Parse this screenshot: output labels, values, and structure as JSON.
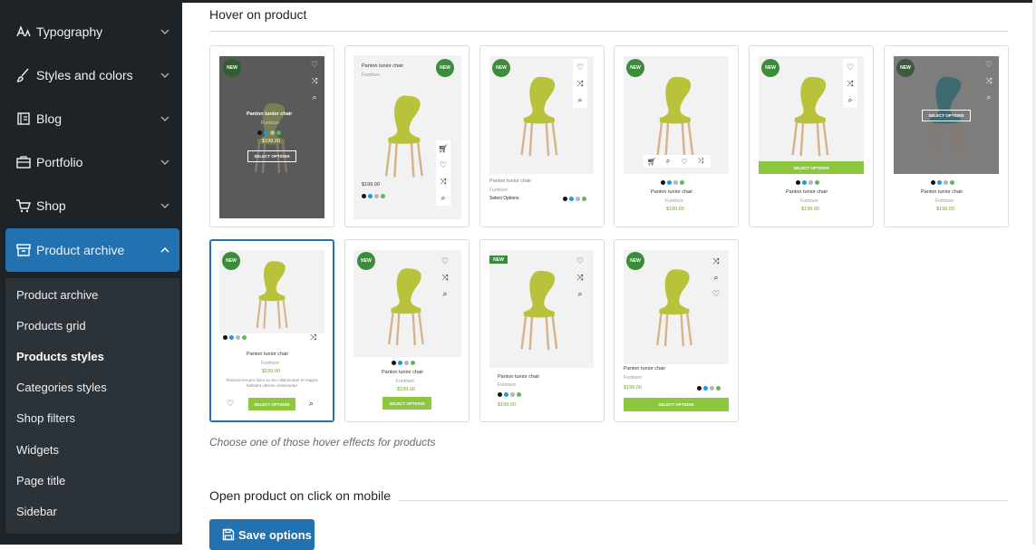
{
  "sidebar": {
    "items": [
      {
        "label": "Typography",
        "icon": "typography-icon"
      },
      {
        "label": "Styles and colors",
        "icon": "brush-icon"
      },
      {
        "label": "Blog",
        "icon": "blog-icon"
      },
      {
        "label": "Portfolio",
        "icon": "briefcase-icon"
      },
      {
        "label": "Shop",
        "icon": "cart-icon"
      },
      {
        "label": "Product archive",
        "icon": "archive-icon"
      }
    ],
    "sub_items": [
      "Product archive",
      "Products grid",
      "Products styles",
      "Categories styles",
      "Shop filters",
      "Widgets",
      "Page title",
      "Sidebar"
    ],
    "active_sub": "Products styles"
  },
  "main": {
    "hover_title": "Hover on product",
    "hint": "Choose one of those hover effects for products",
    "mobile_title": "Open product on click on mobile",
    "save_label": "Save options"
  },
  "product": {
    "badge": "NEW",
    "title": "Panton tunior chair",
    "category": "Furniture",
    "price": "$199.00",
    "select_options": "SELECT OPTIONS",
    "select_options_link": "Select Options",
    "description": "Placerat tempor dolor eu leo ullamcorper et magna habitant ultrices consectetur"
  },
  "colors": {
    "accent": "#2271b1",
    "sidebar_bg": "#1d2327",
    "badge": "#3b8d3b",
    "button_green": "#8dc63f",
    "price_green": "#6aa628",
    "swatches": [
      "#111111",
      "#1e9ad6",
      "#b5b5b5",
      "#5cb85c"
    ]
  }
}
